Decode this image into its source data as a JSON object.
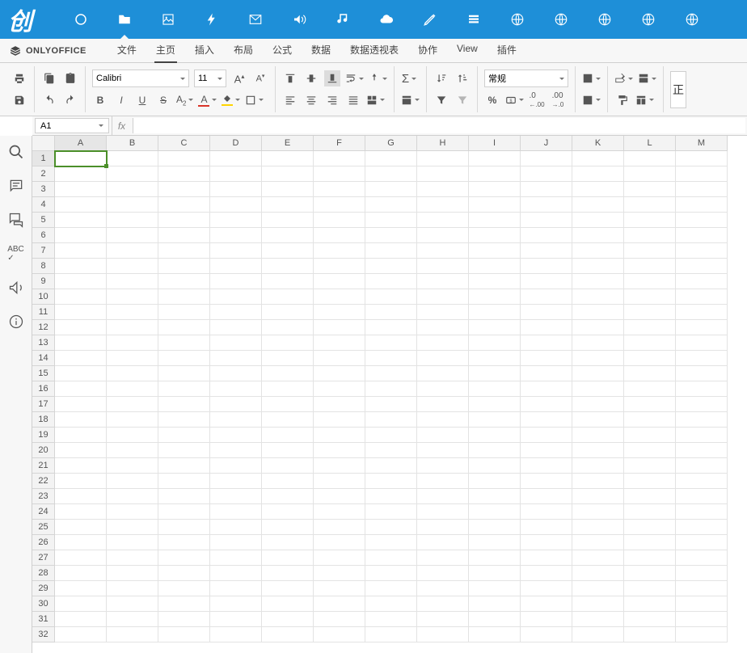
{
  "os_bar": {
    "logo": "创",
    "icons": [
      "circle",
      "folder",
      "image",
      "bolt",
      "mail",
      "sound",
      "music",
      "cloud",
      "pencil",
      "stack",
      "globe",
      "globe",
      "globe",
      "globe",
      "globe"
    ]
  },
  "app": {
    "brand": "ONLYOFFICE",
    "menu": [
      "文件",
      "主页",
      "插入",
      "布局",
      "公式",
      "数据",
      "数据透视表",
      "协作",
      "View",
      "插件"
    ],
    "active_menu_index": 1
  },
  "ribbon": {
    "font_name": "Calibri",
    "font_size": "11",
    "number_format": "常规",
    "cell_style_label": "正"
  },
  "formula_bar": {
    "cell_ref": "A1",
    "fx_label": "fx",
    "formula": ""
  },
  "sheet": {
    "columns": [
      "A",
      "B",
      "C",
      "D",
      "E",
      "F",
      "G",
      "H",
      "I",
      "J",
      "K",
      "L",
      "M"
    ],
    "row_count": 32,
    "active": {
      "col_index": 0,
      "row": 1
    }
  },
  "sidebar": {
    "icons": [
      "search",
      "comment",
      "chat",
      "spellcheck",
      "feedback",
      "info"
    ]
  }
}
